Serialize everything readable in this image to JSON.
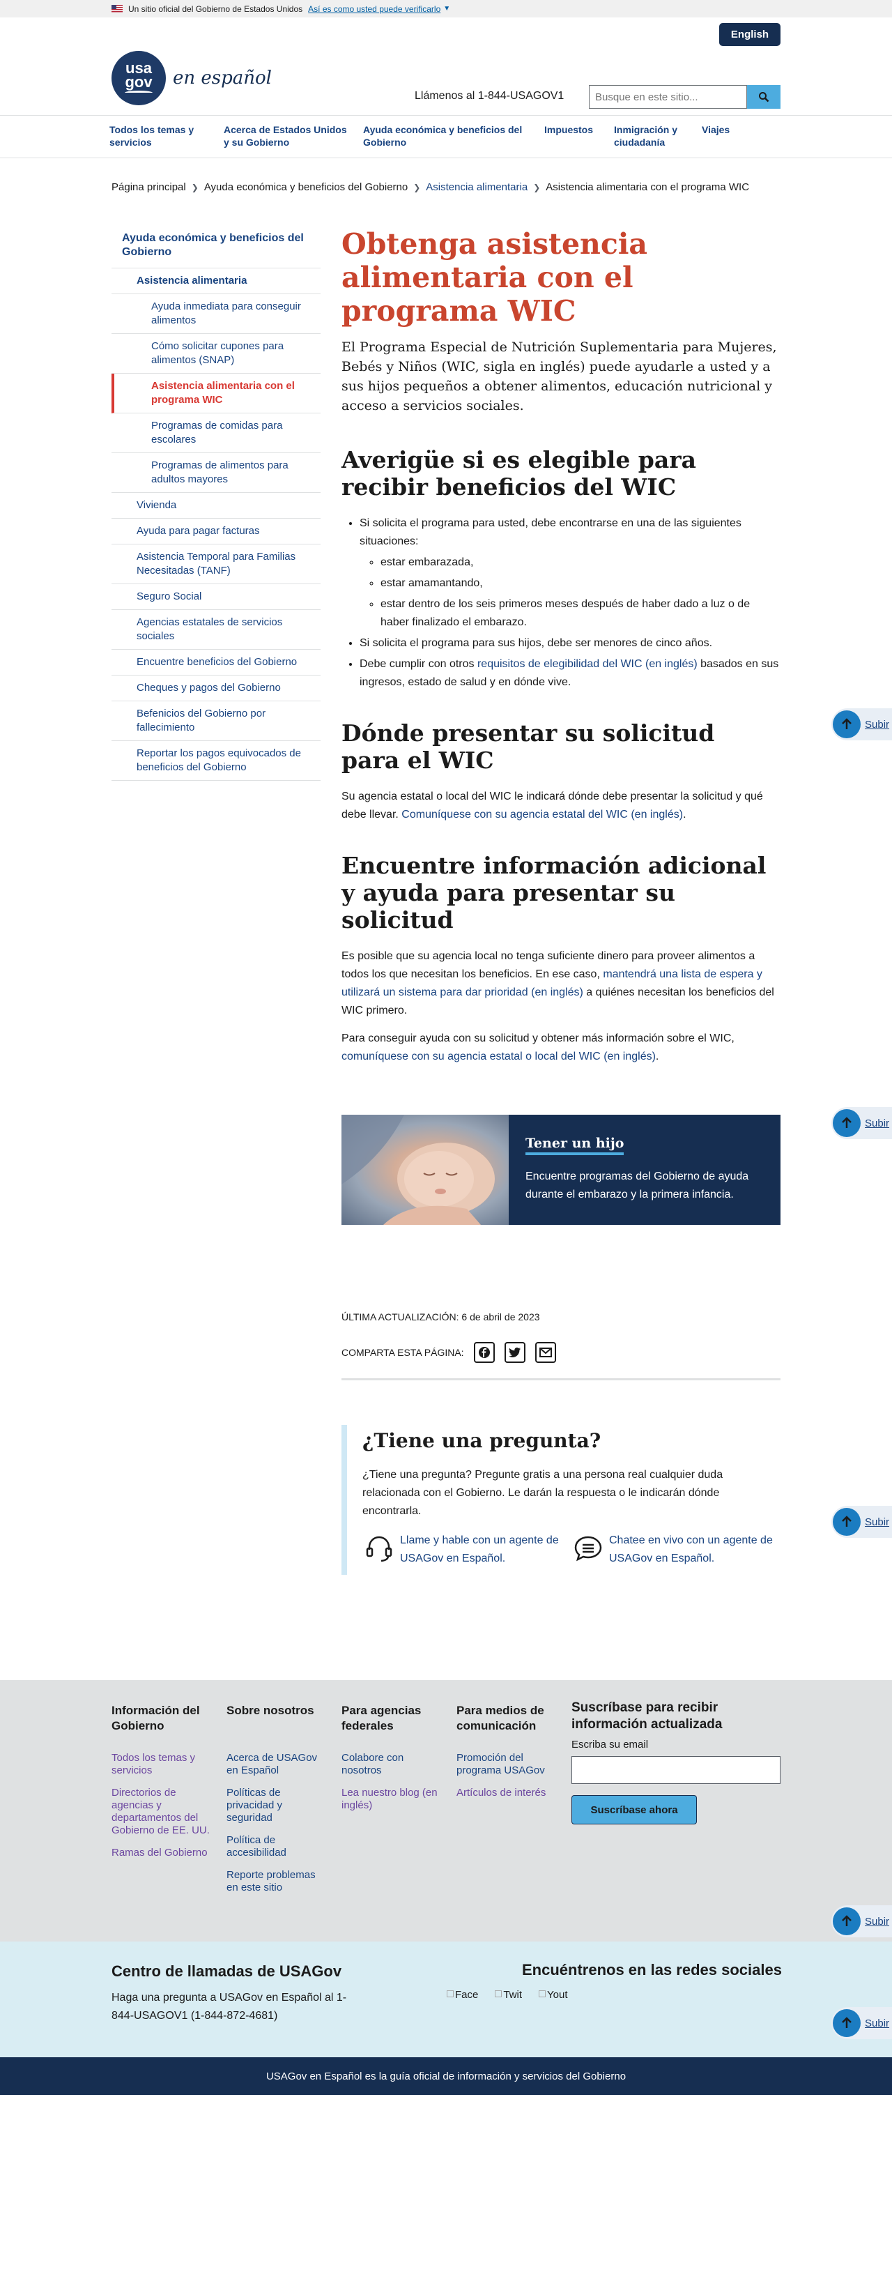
{
  "gov_banner": {
    "text": "Un sitio oficial del Gobierno de Estados Unidos",
    "link": "Así es como usted puede verificarlo"
  },
  "header": {
    "language_button": "English",
    "logo_main": "usa gov",
    "logo_tagline": "en español",
    "phone": "Llámenos al 1-844-USAGOV1",
    "search_placeholder": "Busque en este sitio..."
  },
  "nav": [
    "Todos los temas y servicios",
    "Acerca de Estados Unidos y su Gobierno",
    "Ayuda económica y beneficios del Gobierno",
    "Impuestos",
    "Inmigración y ciudadanía",
    "Viajes"
  ],
  "breadcrumb": [
    "Página principal",
    "Ayuda económica y beneficios del Gobierno",
    "Asistencia alimentaria",
    "Asistencia alimentaria con el programa WIC"
  ],
  "sidebar": {
    "section": "Ayuda económica y beneficios del Gobierno",
    "parent": "Asistencia alimentaria",
    "children": [
      "Ayuda inmediata para conseguir alimentos",
      "Cómo solicitar cupones para alimentos (SNAP)",
      "Asistencia alimentaria con el programa WIC",
      "Programas de comidas para escolares",
      "Programas de alimentos para adultos mayores"
    ],
    "siblings": [
      "Vivienda",
      "Ayuda para pagar facturas",
      "Asistencia Temporal para Familias Necesitadas (TANF)",
      "Seguro Social",
      "Agencias estatales de servicios sociales",
      "Encuentre beneficios del Gobierno",
      "Cheques y pagos del Gobierno",
      "Befenicios del Gobierno por fallecimiento",
      "Reportar los pagos equivocados de beneficios del Gobierno"
    ]
  },
  "main": {
    "title": "Obtenga asistencia alimentaria con el programa WIC",
    "intro": "El Programa Especial de Nutrición Suplementaria para Mujeres, Bebés y Niños (WIC, sigla en inglés) puede ayudarle a usted y a sus hijos pequeños a obtener alimentos, educación nutricional y acceso a servicios sociales.",
    "h2_eligibility": "Averigüe si es elegible para recibir beneficios del WIC",
    "elig_item1": "Si solicita el programa para usted, debe encontrarse en una de las siguientes situaciones:",
    "elig_sub": [
      "estar embarazada,",
      "estar amamantando,",
      "estar dentro de los seis primeros meses después de haber dado a luz o de haber finalizado el embarazo."
    ],
    "elig_item2": "Si solicita el programa para sus hijos, debe ser menores de cinco años.",
    "elig_item3_pre": "Debe cumplir con otros ",
    "elig_item3_link": "requisitos de elegibilidad del WIC (en inglés)",
    "elig_item3_post": " basados en sus ingresos, estado de salud y en dónde vive.",
    "h2_where": "Dónde presentar su solicitud para el WIC",
    "where_text": "Su agencia estatal o local del WIC le indicará dónde debe presentar la solicitud y qué debe llevar. ",
    "where_link": "Comuníquese con su agencia estatal del WIC (en inglés)",
    "h2_more": "Encuentre información adicional y ayuda para presentar su solicitud",
    "more_p1_pre": "Es posible que su agencia local no tenga suficiente dinero para proveer alimentos a todos los que necesitan los beneficios. En ese caso, ",
    "more_p1_link": "mantendrá una lista de espera y utilizará un sistema para dar prioridad (en inglés)",
    "more_p1_post": " a quiénes necesitan los beneficios del WIC primero.",
    "more_p2_pre": "Para conseguir ayuda con su solicitud y obtener más información sobre el WIC, ",
    "more_p2_link": "comuníquese con su agencia estatal o local del WIC (en inglés)",
    "card_title": "Tener un hijo",
    "card_desc": "Encuentre programas del Gobierno de ayuda durante el embarazo y la primera infancia.",
    "updated": "ÚLTIMA ACTUALIZACIÓN: 6 de abril de 2023",
    "share_label": "COMPARTA ESTA PÁGINA:"
  },
  "question": {
    "title": "¿Tiene una pregunta?",
    "text": "¿Tiene una pregunta? Pregunte gratis a una persona real cualquier duda relacionada con el Gobierno. Le darán la respuesta o le indicarán dónde encontrarla.",
    "call_link": "Llame y hable con un agente de USAGov en Español.",
    "chat_link": "Chatee en vivo con un agente de USAGov en Español."
  },
  "back_to_top": "Subir",
  "footer": {
    "col1_title": "Información del Gobierno",
    "col1_links": [
      "Todos los temas y servicios",
      "Directorios de agencias y departamentos del Gobierno de EE. UU.",
      "Ramas del Gobierno"
    ],
    "col2_title": "Sobre nosotros",
    "col2_links": [
      "Acerca de USAGov en Español",
      "Políticas de privacidad y seguridad",
      "Política de accesibilidad",
      "Reporte problemas en este sitio"
    ],
    "col3_title": "Para agencias federales",
    "col3_links": [
      "Colabore con nosotros",
      "Lea nuestro blog (en inglés)"
    ],
    "col4_title": "Para medios de comunicación",
    "col4_links": [
      "Promoción del programa USAGov",
      "Artículos de interés"
    ],
    "subscribe_title": "Suscríbase para recibir información actualizada",
    "subscribe_label": "Escriba su email",
    "subscribe_button": "Suscríbase ahora"
  },
  "call_center": {
    "title": "Centro de llamadas de USAGov",
    "text": "Haga una pregunta a USAGov en Español al 1-844-USAGOV1 (1-844-872-4681)"
  },
  "social": {
    "title": "Encuéntrenos en las redes sociales",
    "items": [
      "Face",
      "Twit",
      "Yout"
    ]
  },
  "bottom_bar": "USAGov en Español es la guía oficial de información y servicios del Gobierno",
  "colors": {
    "navy": "#162e51",
    "accent_red": "#c9452e",
    "link_blue": "#1a4480",
    "cyan": "#4dacdf"
  }
}
